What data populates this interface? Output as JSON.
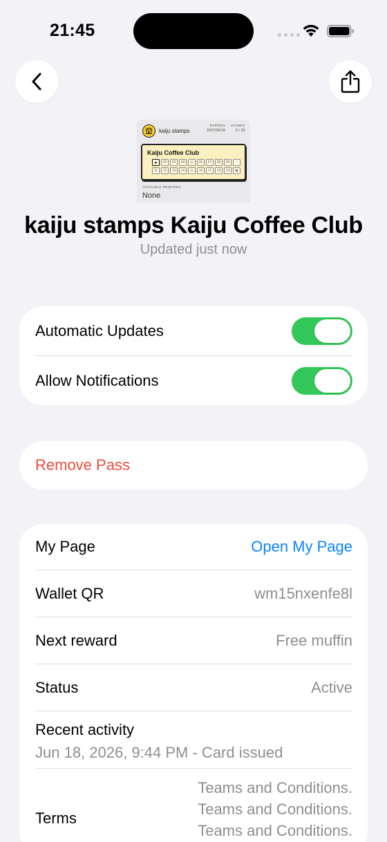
{
  "status_bar": {
    "time": "21:45"
  },
  "pass": {
    "thumbnail": {
      "brand": "kaiju stamps",
      "expires_label": "EXPIRES",
      "expires_value": "2027/06/18",
      "stamps_label": "STAMPS",
      "stamps_value": "0 / 20",
      "card_title": "Kaiju Coffee Club",
      "cells_row1": [
        "+",
        "02",
        "03",
        "04",
        "",
        "06",
        "07",
        "08",
        "09",
        ""
      ],
      "cells_row2": [
        "11",
        "12",
        "13",
        "14",
        "",
        "16",
        "17",
        "18",
        "19",
        ""
      ],
      "rewards_label": "AVAILABLE REWARDS",
      "rewards_value": "None",
      "logo_color": "#f7cc2b",
      "card_color": "#fbf1c0"
    },
    "title": "kaiju stamps Kaiju Coffee Club",
    "subtitle": "Updated just now"
  },
  "settings": {
    "automatic_updates": {
      "label": "Automatic Updates",
      "enabled": true
    },
    "allow_notifications": {
      "label": "Allow Notifications",
      "enabled": true
    }
  },
  "remove_pass": {
    "label": "Remove Pass",
    "color": "#eb4d3d"
  },
  "details": {
    "my_page": {
      "label": "My Page",
      "value": "Open My Page"
    },
    "wallet_qr": {
      "label": "Wallet QR",
      "value": "wm15nxenfe8l"
    },
    "next_reward": {
      "label": "Next reward",
      "value": "Free muffin"
    },
    "status": {
      "label": "Status",
      "value": "Active"
    },
    "recent_activity": {
      "label": "Recent activity",
      "value": "Jun 18, 2026, 9:44 PM - Card issued"
    },
    "terms": {
      "label": "Terms",
      "lines": [
        "Teams and Conditions.",
        "Teams and Conditions.",
        "Teams and Conditions."
      ]
    }
  },
  "colors": {
    "accent": "#0a84ff",
    "toggle_on": "#34c759",
    "background": "#f2f2f7"
  }
}
